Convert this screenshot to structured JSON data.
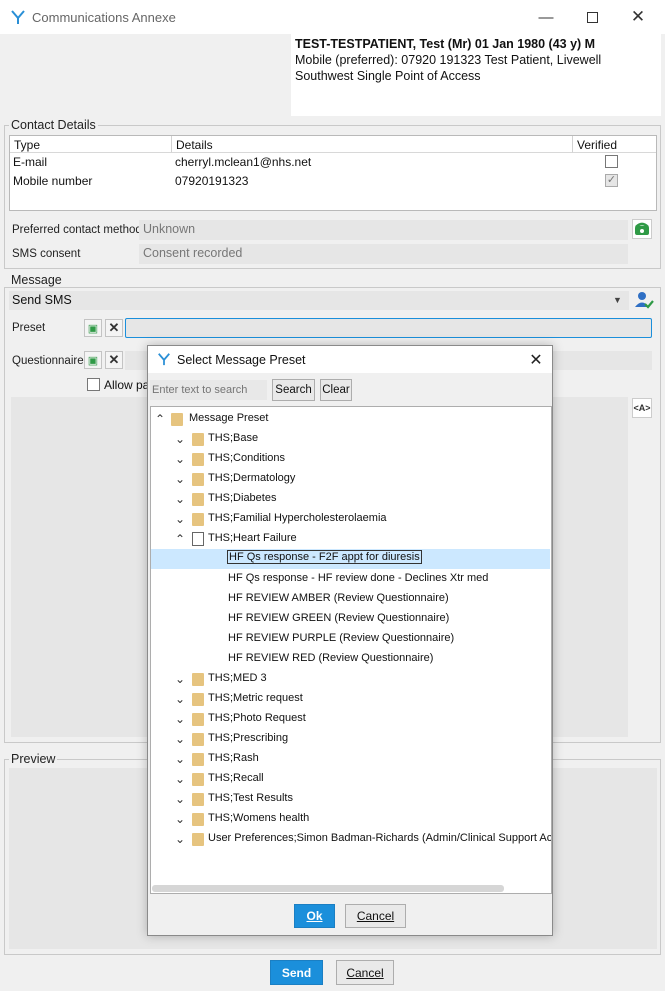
{
  "window": {
    "title": "Communications Annexe"
  },
  "patient": {
    "name_line": "TEST-TESTPATIENT, Test (Mr) 01 Jan 1980 (43 y) M",
    "mobile_line": "Mobile (preferred): 07920 191323   Test Patient, Livewell",
    "org_line": "Southwest Single Point of Access"
  },
  "contact": {
    "group_label": "Contact Details",
    "columns": [
      "Type",
      "Details",
      "Verified"
    ],
    "rows": [
      {
        "type": "E-mail",
        "details": "cherryl.mclean1@nhs.net",
        "verified": false
      },
      {
        "type": "Mobile number",
        "details": "07920191323",
        "verified": true
      }
    ],
    "preferred_label": "Preferred contact method",
    "preferred_value": "Unknown",
    "sms_label": "SMS consent",
    "sms_value": "Consent recorded"
  },
  "message": {
    "group_label": "Message",
    "send_type": "Send SMS",
    "preset_label": "Preset",
    "questionnaire_label": "Questionnaire",
    "allow_label": "Allow pa"
  },
  "preview": {
    "group_label": "Preview"
  },
  "footer": {
    "send_label": "Send",
    "cancel_label": "Cancel"
  },
  "dialog": {
    "title": "Select Message Preset",
    "search_placeholder": "Enter text to search",
    "search_label": "Search",
    "clear_label": "Clear",
    "ok_label": "Ok",
    "cancel_label": "Cancel",
    "tree": [
      {
        "label": "Message Preset",
        "level": 0,
        "kind": "root",
        "expanded": true
      },
      {
        "label": "THS;Base",
        "level": 1,
        "kind": "folder",
        "expanded": false
      },
      {
        "label": "THS;Conditions",
        "level": 1,
        "kind": "folder",
        "expanded": false
      },
      {
        "label": "THS;Dermatology",
        "level": 1,
        "kind": "folder",
        "expanded": false
      },
      {
        "label": "THS;Diabetes",
        "level": 1,
        "kind": "folder",
        "expanded": false
      },
      {
        "label": "THS;Familial Hypercholesterolaemia",
        "level": 1,
        "kind": "folder",
        "expanded": false
      },
      {
        "label": "THS;Heart Failure",
        "level": 1,
        "kind": "open",
        "expanded": true
      },
      {
        "label": "HF Qs response - F2F appt for diuresis",
        "level": 2,
        "kind": "item",
        "selected": true
      },
      {
        "label": "HF Qs response - HF review done - Declines Xtr med",
        "level": 2,
        "kind": "item"
      },
      {
        "label": "HF REVIEW AMBER (Review Questionnaire)",
        "level": 2,
        "kind": "item"
      },
      {
        "label": "HF REVIEW GREEN (Review Questionnaire)",
        "level": 2,
        "kind": "item"
      },
      {
        "label": "HF REVIEW PURPLE (Review Questionnaire)",
        "level": 2,
        "kind": "item"
      },
      {
        "label": "HF REVIEW RED (Review Questionnaire)",
        "level": 2,
        "kind": "item"
      },
      {
        "label": "THS;MED 3",
        "level": 1,
        "kind": "folder",
        "expanded": false
      },
      {
        "label": "THS;Metric request",
        "level": 1,
        "kind": "folder",
        "expanded": false
      },
      {
        "label": "THS;Photo Request",
        "level": 1,
        "kind": "folder",
        "expanded": false
      },
      {
        "label": "THS;Prescribing",
        "level": 1,
        "kind": "folder",
        "expanded": false
      },
      {
        "label": "THS;Rash",
        "level": 1,
        "kind": "folder",
        "expanded": false
      },
      {
        "label": "THS;Recall",
        "level": 1,
        "kind": "folder",
        "expanded": false
      },
      {
        "label": "THS;Test Results",
        "level": 1,
        "kind": "folder",
        "expanded": false
      },
      {
        "label": "THS;Womens health",
        "level": 1,
        "kind": "folder",
        "expanded": false
      },
      {
        "label": "User Preferences;Simon Badman-Richards (Admin/Clinical Support Acc",
        "level": 1,
        "kind": "folder",
        "expanded": false
      }
    ]
  },
  "colors": {
    "accent": "#1b8fdb",
    "selection": "#cce8ff",
    "folder": "#e6c47f"
  }
}
